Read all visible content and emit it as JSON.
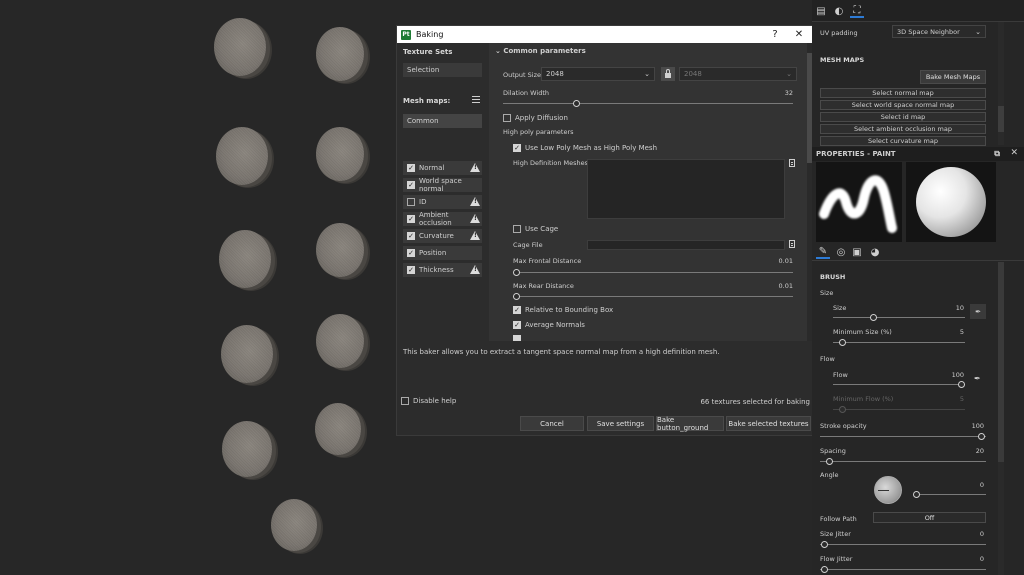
{
  "dialog": {
    "title": "Baking",
    "help_icon": "?",
    "close_icon": "✕",
    "app_logo": "Pt"
  },
  "left": {
    "texture_sets_label": "Texture Sets",
    "texture_set_value": "Selection",
    "mesh_maps_label": "Mesh maps:",
    "common_label": "Common",
    "mesh_maps": [
      {
        "label": "Normal",
        "checked": true,
        "warning": true
      },
      {
        "label": "World space normal",
        "checked": true,
        "warning": false
      },
      {
        "label": "ID",
        "checked": false,
        "warning": true
      },
      {
        "label": "Ambient occlusion",
        "checked": true,
        "warning": true
      },
      {
        "label": "Curvature",
        "checked": true,
        "warning": true
      },
      {
        "label": "Position",
        "checked": true,
        "warning": false
      },
      {
        "label": "Thickness",
        "checked": true,
        "warning": true
      }
    ]
  },
  "common": {
    "section_title": "Common parameters",
    "output_size_label": "Output Size",
    "output_size_value": "2048",
    "output_size_linked_value": "2048",
    "dilation_label": "Dilation Width",
    "dilation_value": "32",
    "apply_diffusion": "Apply Diffusion",
    "high_poly_params": "High poly parameters",
    "use_low_poly": "Use Low Poly Mesh as High Poly Mesh",
    "high_def_meshes": "High Definition Meshes",
    "use_cage": "Use Cage",
    "cage_file": "Cage File",
    "max_frontal_label": "Max Frontal Distance",
    "max_frontal_value": "0.01",
    "max_rear_label": "Max Rear Distance",
    "max_rear_value": "0.01",
    "relative_bbox": "Relative to Bounding Box",
    "average_normals": "Average Normals"
  },
  "help_text": "This baker allows you to extract a tangent space normal map from a high definition mesh.",
  "footer": {
    "disable_help": "Disable help",
    "selected_count": "66 textures selected for baking",
    "cancel": "Cancel",
    "save_settings": "Save settings",
    "bake_ground": "Bake button_ground",
    "bake_selected": "Bake selected textures"
  },
  "bake_panel": {
    "uv_padding_label": "UV padding",
    "uv_padding_value": "3D Space Neighbor",
    "mesh_maps_title": "MESH MAPS",
    "bake_mesh_maps": "Bake Mesh Maps",
    "buttons": [
      "Select normal map",
      "Select world space normal map",
      "Select id map",
      "Select ambient occlusion map",
      "Select curvature map"
    ]
  },
  "properties": {
    "title": "PROPERTIES - PAINT",
    "brush_title": "BRUSH",
    "size_group": "Size",
    "size_label": "Size",
    "size_value": "10",
    "min_size_label": "Minimum Size (%)",
    "min_size_value": "5",
    "flow_group": "Flow",
    "flow_label": "Flow",
    "flow_value": "100",
    "min_flow_label": "Minimum Flow (%)",
    "min_flow_value": "5",
    "stroke_opacity_label": "Stroke opacity",
    "stroke_opacity_value": "100",
    "spacing_label": "Spacing",
    "spacing_value": "20",
    "angle_label": "Angle",
    "angle_value": "0",
    "follow_path_label": "Follow Path",
    "follow_path_value": "Off",
    "size_jitter_label": "Size Jitter",
    "size_jitter_value": "0",
    "flow_jitter_label": "Flow Jitter",
    "flow_jitter_value": "0"
  },
  "icons": {
    "warning": "warning-icon",
    "checkbox": "checkbox-icon",
    "lock": "lock-icon",
    "file": "file-icon"
  }
}
